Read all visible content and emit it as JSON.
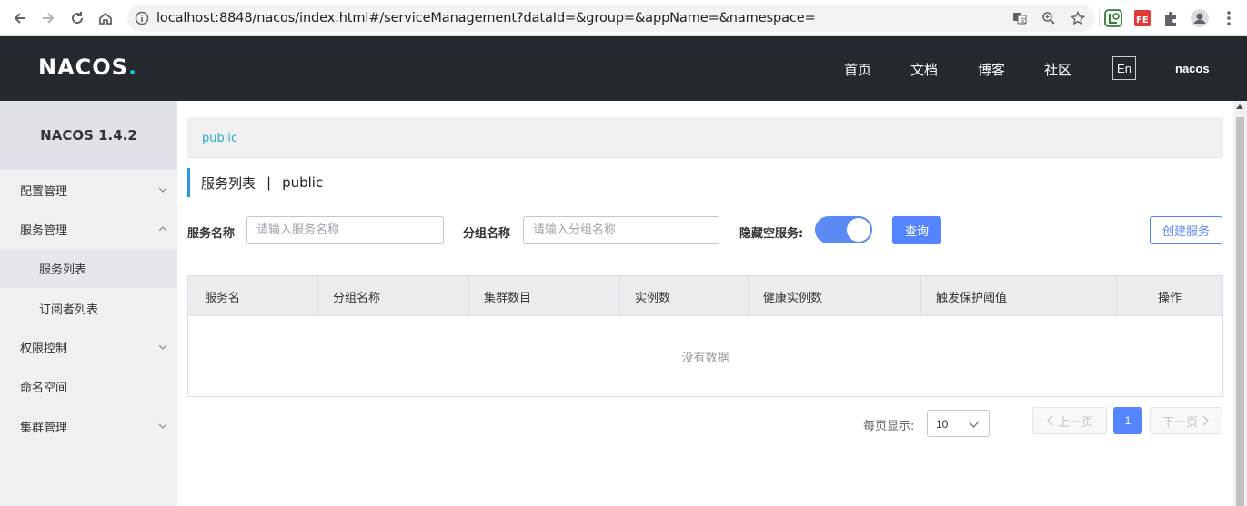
{
  "browser": {
    "url": "localhost:8848/nacos/index.html#/serviceManagement?dataId=&group=&appName=&namespace="
  },
  "header": {
    "logo": "NACOS",
    "logo_dot": ".",
    "nav": [
      "首页",
      "文档",
      "博客",
      "社区"
    ],
    "lang": "En",
    "user": "nacos"
  },
  "sidebar": {
    "title": "NACOS 1.4.2",
    "items": [
      {
        "label": "配置管理",
        "chevron": "down"
      },
      {
        "label": "服务管理",
        "chevron": "up"
      },
      {
        "label": "服务列表"
      },
      {
        "label": "订阅者列表"
      },
      {
        "label": "权限控制",
        "chevron": "down"
      },
      {
        "label": "命名空间"
      },
      {
        "label": "集群管理",
        "chevron": "down"
      }
    ]
  },
  "namespace": {
    "current": "public"
  },
  "page": {
    "title": "服务列表",
    "separator": "|",
    "namespace": "public"
  },
  "form": {
    "service_name_label": "服务名称",
    "service_name_placeholder": "请输入服务名称",
    "group_name_label": "分组名称",
    "group_name_placeholder": "请输入分组名称",
    "hide_empty_label": "隐藏空服务:",
    "hide_empty_on": true,
    "query_button": "查询",
    "create_button": "创建服务"
  },
  "table": {
    "columns": [
      "服务名",
      "分组名称",
      "集群数目",
      "实例数",
      "健康实例数",
      "触发保护阈值",
      "操作"
    ],
    "empty_text": "没有数据"
  },
  "pagination": {
    "page_size_label": "每页显示:",
    "page_size": "10",
    "prev": "上一页",
    "current_page": "1",
    "next": "下一页"
  },
  "colors": {
    "header_bg": "#252a2f",
    "primary": "#5584ff",
    "namespace_link": "#2dabd1",
    "accent_bar": "#2994e0"
  }
}
